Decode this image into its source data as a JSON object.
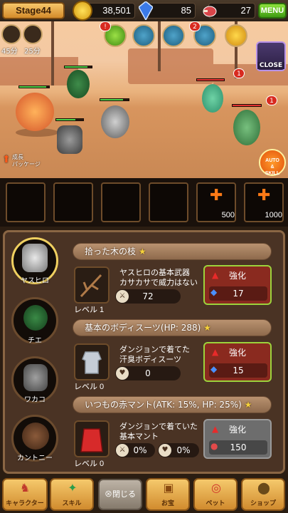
{
  "topbar": {
    "stage": "Stage44",
    "gold": "38,501",
    "gems": "85",
    "meat": "27",
    "menu_label": "MENU"
  },
  "scene": {
    "timer1": "45分",
    "timer2": "25分",
    "badges": [
      "!",
      "2"
    ],
    "enemy_badges": [
      "1",
      "1"
    ],
    "close_label": "CLOSE",
    "boost_label": "成長\nパッケージ",
    "auto_label": "AUTO\n&\nSKILL"
  },
  "slots": {
    "costs": [
      "500",
      "1000"
    ]
  },
  "panel": {
    "characters": [
      {
        "name": "ヤスヒロ"
      },
      {
        "name": "チエ"
      },
      {
        "name": "ワカコ"
      },
      {
        "name": "カントニー"
      }
    ],
    "items": [
      {
        "header": "拾った木の枝",
        "desc1": "ヤスヒロの基本武器",
        "desc2": "カサカサで威力はない",
        "stat1": "72",
        "level": "レベル 1",
        "enhance_label": "強化",
        "cost": "17",
        "enabled": true
      },
      {
        "header": "基本のボディスーツ(HP: 288)",
        "desc1": "ダンジョンで着てた",
        "desc2": "汗臭ボディスーツ",
        "stat1": "0",
        "level": "レベル 0",
        "enhance_label": "強化",
        "cost": "15",
        "enabled": true
      },
      {
        "header": "いつもの赤マント(ATK: 15%, HP: 25%)",
        "desc1": "ダンジョンで着ていた",
        "desc2": "基本マント",
        "stat1": "0%",
        "stat2": "0%",
        "level": "レベル 0",
        "enhance_label": "強化",
        "cost": "150",
        "enabled": false
      }
    ]
  },
  "nav": {
    "character": "キャラクター",
    "skill": "スキル",
    "close": "⊗閉じる",
    "treasure": "お宝",
    "pet": "ペット",
    "shop": "ショップ"
  },
  "colors": {
    "accent_orange": "#d18b2e",
    "enhance_red": "#8a2a1f",
    "enhance_border": "#9cd33b",
    "menu_green": "#3f9b12"
  }
}
